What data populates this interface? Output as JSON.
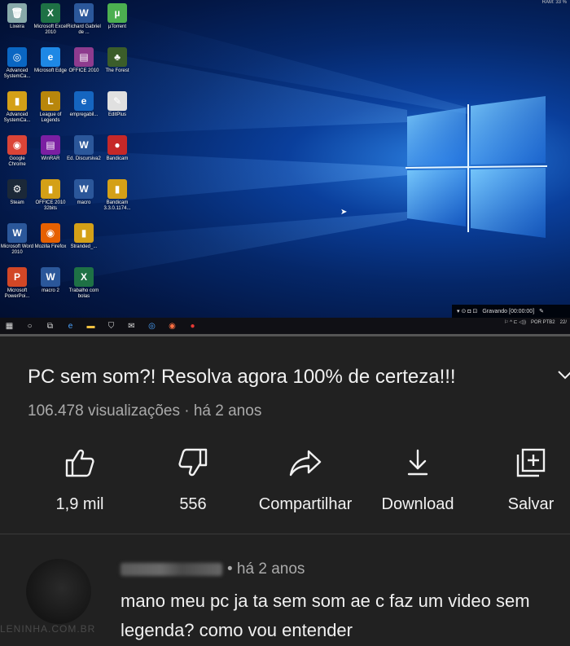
{
  "video": {
    "desktop_icons": [
      {
        "label": "Lixeira",
        "color": "#8aa",
        "glyph": "🗑",
        "col": 0,
        "row": 0
      },
      {
        "label": "Microsoft Excel 2010",
        "color": "#1e7145",
        "glyph": "X",
        "col": 1,
        "row": 0
      },
      {
        "label": "Richard Gabriel de ...",
        "color": "#2b579a",
        "glyph": "W",
        "col": 2,
        "row": 0
      },
      {
        "label": "µTorrent",
        "color": "#4caf50",
        "glyph": "µ",
        "col": 3,
        "row": 0
      },
      {
        "label": "Advanced SystemCa...",
        "color": "#0a66c2",
        "glyph": "◎",
        "col": 0,
        "row": 1
      },
      {
        "label": "Microsoft Edge",
        "color": "#1e88e5",
        "glyph": "e",
        "col": 1,
        "row": 1
      },
      {
        "label": "OFFICE 2010",
        "color": "#8e3b8e",
        "glyph": "▤",
        "col": 2,
        "row": 1
      },
      {
        "label": "The Forest",
        "color": "#3b5d2a",
        "glyph": "♣",
        "col": 3,
        "row": 1
      },
      {
        "label": "Advanced SystemCa...",
        "color": "#d4a017",
        "glyph": "▮",
        "col": 0,
        "row": 2
      },
      {
        "label": "League of Legends",
        "color": "#b8860b",
        "glyph": "L",
        "col": 1,
        "row": 2
      },
      {
        "label": "empregabil...",
        "color": "#1565c0",
        "glyph": "e",
        "col": 2,
        "row": 2
      },
      {
        "label": "EditPlus",
        "color": "#e0e0e0",
        "glyph": "✎",
        "col": 3,
        "row": 2
      },
      {
        "label": "Google Chrome",
        "color": "#db4437",
        "glyph": "◉",
        "col": 0,
        "row": 3
      },
      {
        "label": "WinRAR",
        "color": "#7b1fa2",
        "glyph": "▤",
        "col": 1,
        "row": 3
      },
      {
        "label": "Ed. Discursiva2",
        "color": "#2b579a",
        "glyph": "W",
        "col": 2,
        "row": 3
      },
      {
        "label": "Bandicam",
        "color": "#c62828",
        "glyph": "●",
        "col": 3,
        "row": 3
      },
      {
        "label": "Steam",
        "color": "#1b2838",
        "glyph": "⚙",
        "col": 0,
        "row": 4
      },
      {
        "label": "OFFICE 2010 32bits",
        "color": "#d4a017",
        "glyph": "▮",
        "col": 1,
        "row": 4
      },
      {
        "label": "macro",
        "color": "#2b579a",
        "glyph": "W",
        "col": 2,
        "row": 4
      },
      {
        "label": "Bandicam 3.3.0.1174...",
        "color": "#d4a017",
        "glyph": "▮",
        "col": 3,
        "row": 4
      },
      {
        "label": "Microsoft Word 2010",
        "color": "#2b579a",
        "glyph": "W",
        "col": 0,
        "row": 5
      },
      {
        "label": "Mozilla Firefox",
        "color": "#e66000",
        "glyph": "◉",
        "col": 1,
        "row": 5
      },
      {
        "label": "Stranded_...",
        "color": "#d4a017",
        "glyph": "▮",
        "col": 2,
        "row": 5
      },
      {
        "label": "Microsoft PowerPoi...",
        "color": "#d24726",
        "glyph": "P",
        "col": 0,
        "row": 6
      },
      {
        "label": "macro 2",
        "color": "#2b579a",
        "glyph": "W",
        "col": 1,
        "row": 6
      },
      {
        "label": "Trabalho com bolas",
        "color": "#1e7145",
        "glyph": "X",
        "col": 2,
        "row": 6
      }
    ],
    "recording_label": "Gravando [00:00:00]",
    "ram_label": "RAM: 33 %",
    "tray_lang": "POR PTB2",
    "tray_date": "22/",
    "progress": 0.0
  },
  "info": {
    "title": "PC sem som?! Resolva agora 100% de certeza!!!",
    "views": "106.478 visualizações",
    "age": "há 2 anos",
    "separator": "·"
  },
  "actions": {
    "like": "1,9 mil",
    "dislike": "556",
    "share": "Compartilhar",
    "download": "Download",
    "save": "Salvar"
  },
  "comment": {
    "age": "• há 2 anos",
    "text": "mano meu pc ja ta sem som ae c faz um video sem legenda? como vou entender",
    "watermark": "LENINHA.COM.BR"
  },
  "colors": {
    "background": "#212121",
    "text": "#f1f1f1",
    "secondary_text": "#aaaaaa",
    "progress": "#ff0000"
  }
}
